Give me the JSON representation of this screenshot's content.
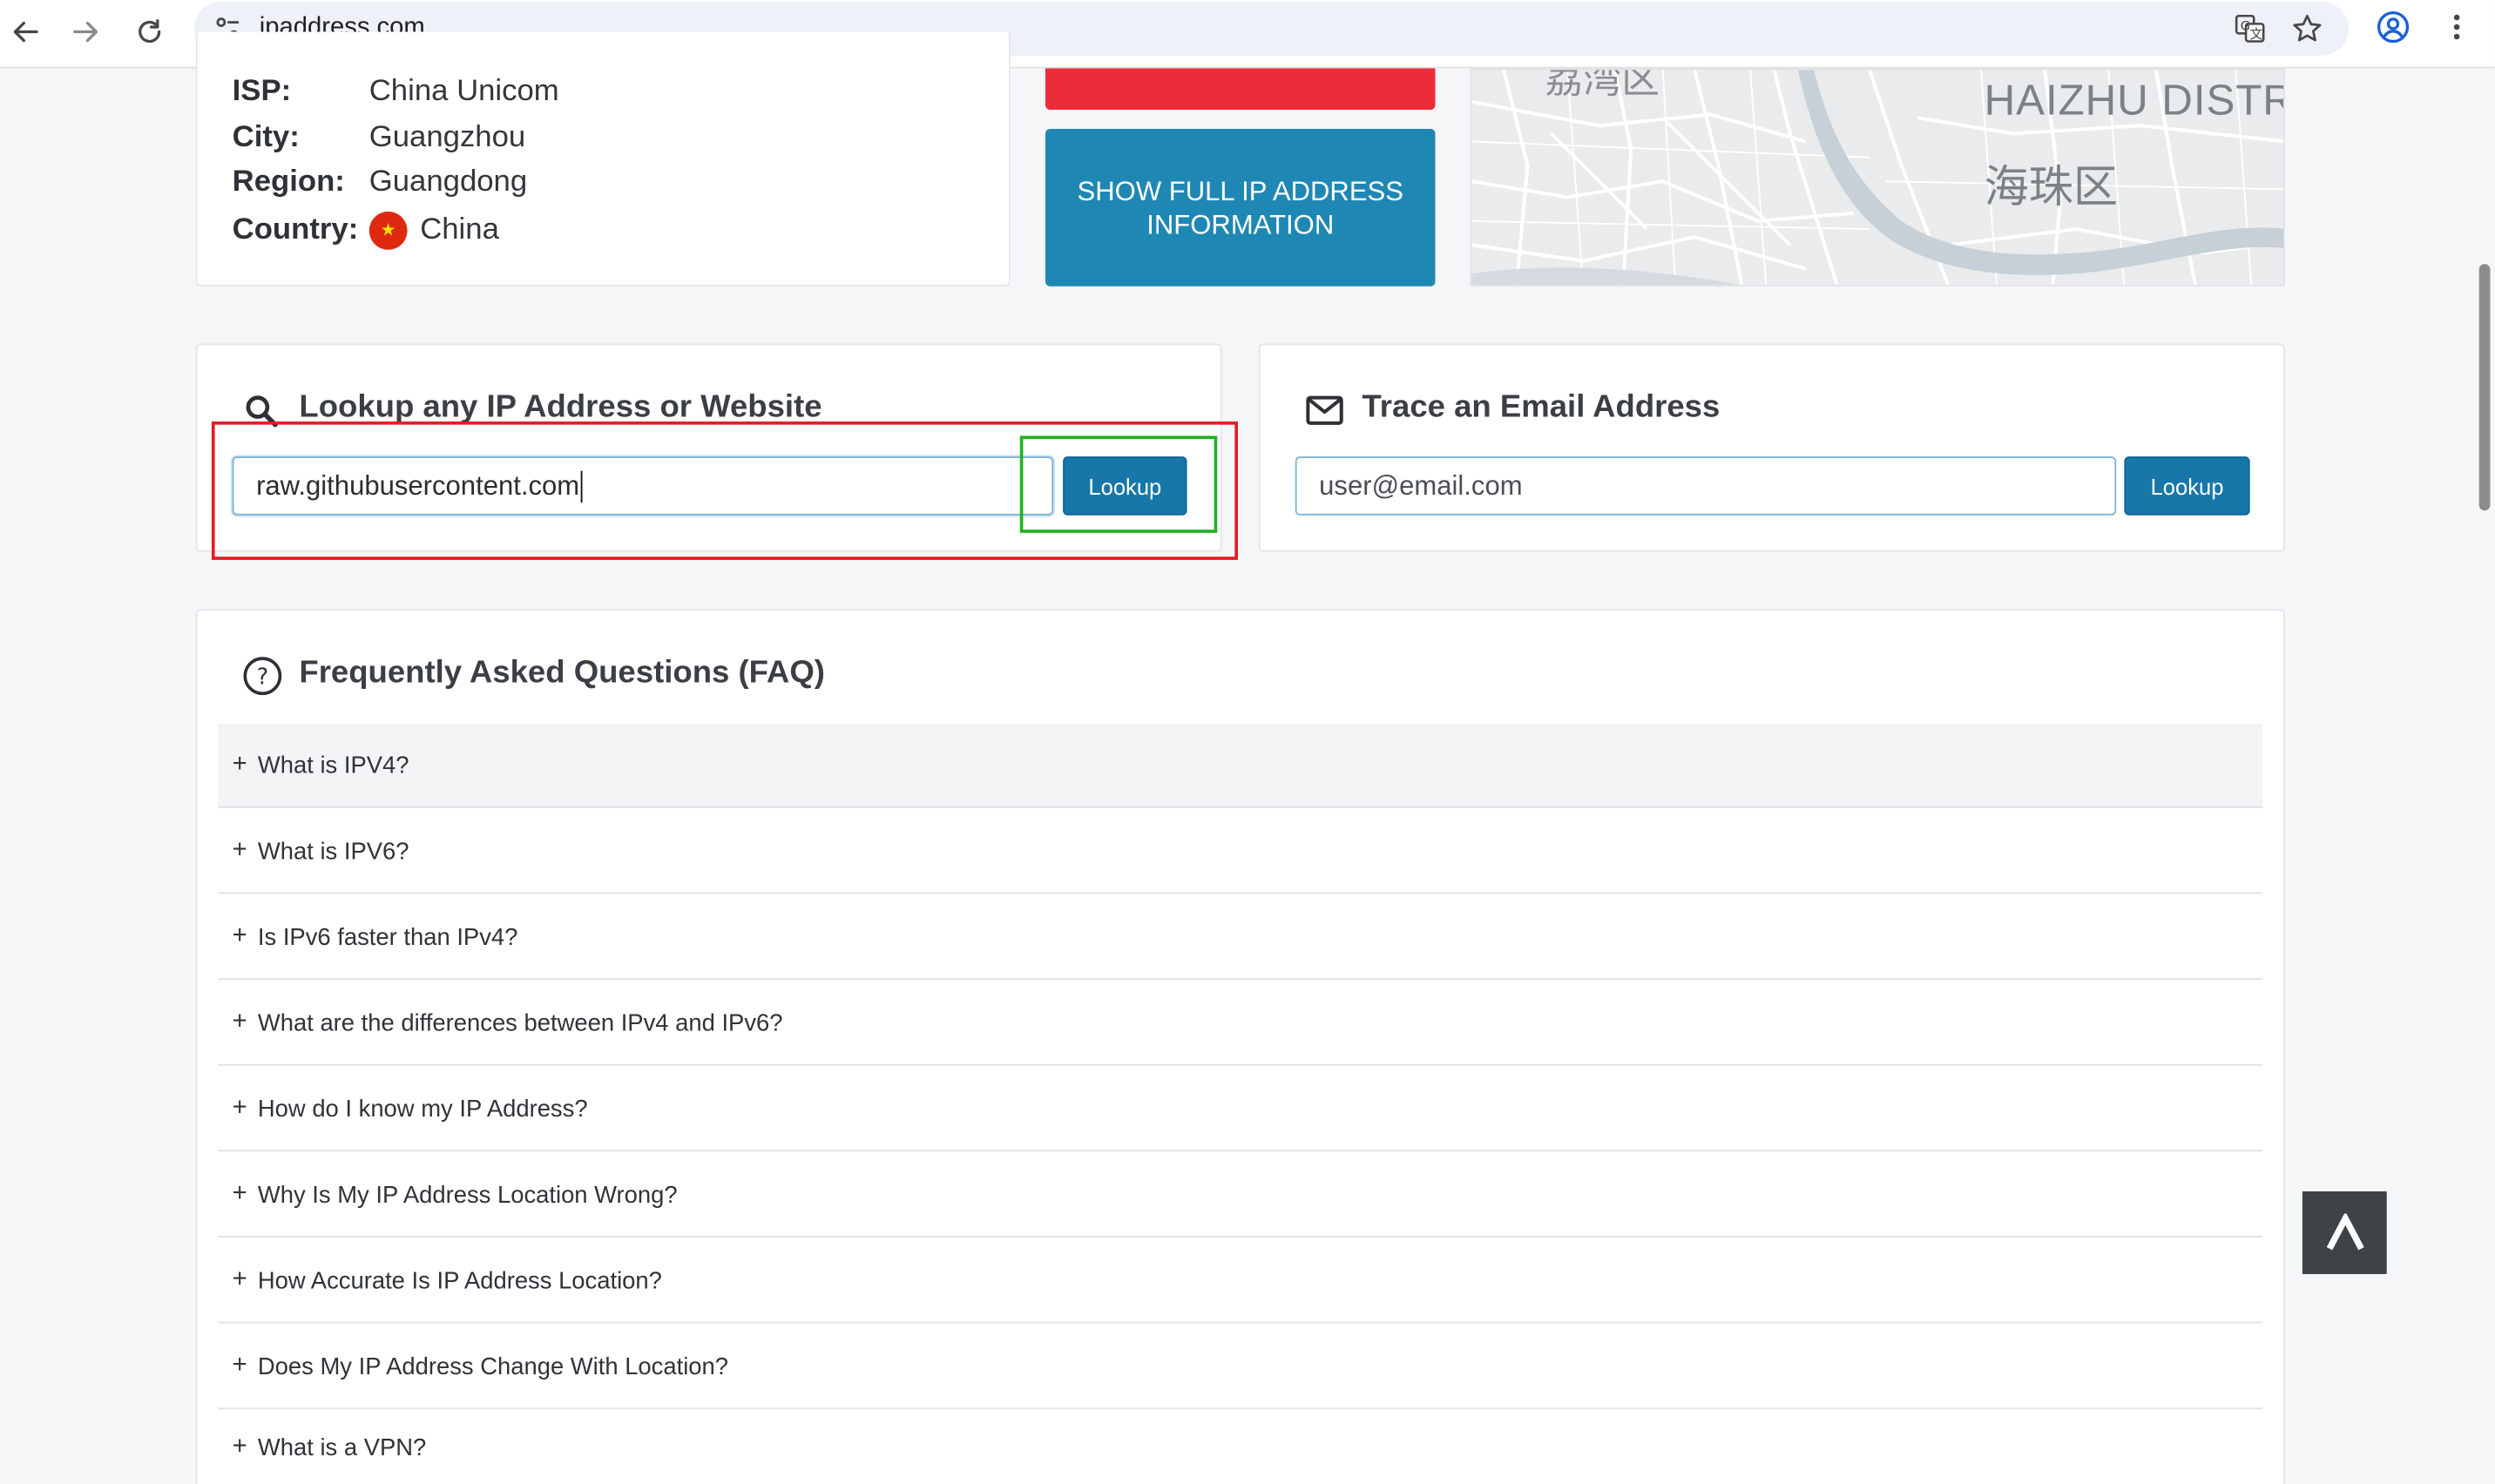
{
  "browser": {
    "url": "ipaddress.com"
  },
  "ip_info": {
    "rows": [
      {
        "label": "ISP:",
        "value": "China Unicom"
      },
      {
        "label": "City:",
        "value": "Guangzhou"
      },
      {
        "label": "Region:",
        "value": "Guangdong"
      },
      {
        "label": "Country:",
        "value": "China"
      }
    ],
    "show_full_button": "SHOW FULL IP ADDRESS INFORMATION"
  },
  "map": {
    "label_en": "HAIZHU DISTR",
    "label_cn": "海珠区",
    "label_top": "荔湾区"
  },
  "lookup": {
    "title": "Lookup any IP Address or Website",
    "input_value": "raw.githubusercontent.com",
    "button": "Lookup"
  },
  "email_trace": {
    "title": "Trace an Email Address",
    "input_value": "user@email.com",
    "button": "Lookup"
  },
  "faq": {
    "title": "Frequently Asked Questions (FAQ)",
    "items": [
      "What is IPV4?",
      "What is IPV6?",
      "Is IPv6 faster than IPv4?",
      "What are the differences between IPv4 and IPv6?",
      "How do I know my IP Address?",
      "Why Is My IP Address Location Wrong?",
      "How Accurate Is IP Address Location?",
      "Does My IP Address Change With Location?",
      "What is a VPN?"
    ]
  },
  "back_to_top": "^",
  "colors": {
    "accent_blue": "#1f87b4",
    "button_blue": "#1677a8",
    "red_bar": "#ee2b38",
    "highlight_red": "#e51c23",
    "highlight_green": "#1fb21f"
  }
}
